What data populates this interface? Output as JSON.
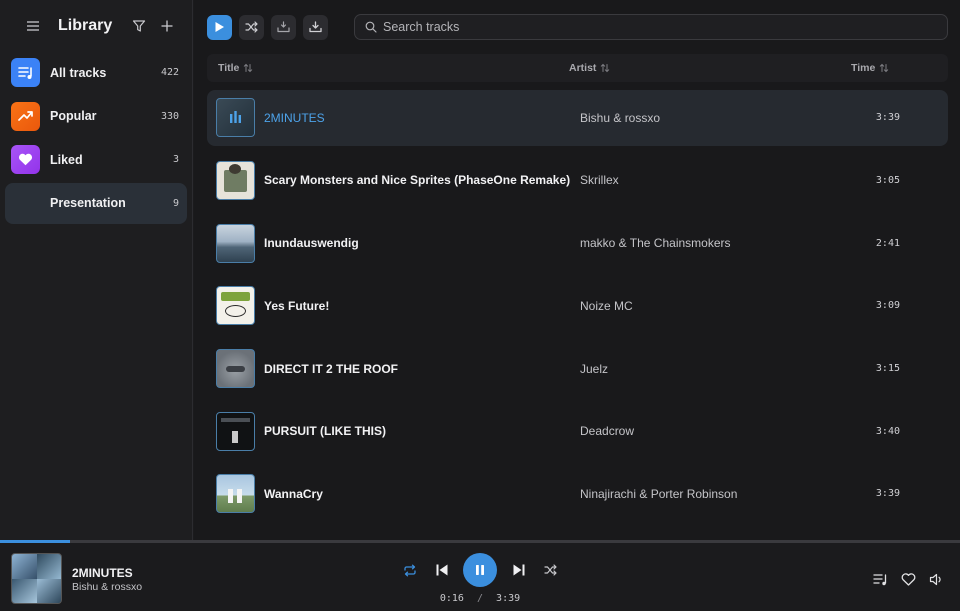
{
  "sidebar": {
    "title": "Library",
    "items": [
      {
        "label": "All tracks",
        "count": "422",
        "icon": "playlist-icon",
        "color": "#3b82f6"
      },
      {
        "label": "Popular",
        "count": "330",
        "icon": "trending-up-icon",
        "color": "#f97316"
      },
      {
        "label": "Liked",
        "count": "3",
        "icon": "heart-icon",
        "color": "#a855f7"
      },
      {
        "label": "Presentation",
        "count": "9",
        "icon": "playlist-cover",
        "active": true
      }
    ]
  },
  "toolbar": {
    "search_placeholder": "Search tracks"
  },
  "table": {
    "headers": {
      "title": "Title",
      "artist": "Artist",
      "time": "Time"
    },
    "rows": [
      {
        "title": "2MINUTES",
        "artist": "Bishu & rossxo",
        "time": "3:39",
        "active": true
      },
      {
        "title": "Scary Monsters and Nice Sprites (PhaseOne Remake)",
        "artist": "Skrillex",
        "time": "3:05"
      },
      {
        "title": "Inundauswendig",
        "artist": "makko & The Chainsmokers",
        "time": "2:41"
      },
      {
        "title": "Yes Future!",
        "artist": "Noize MC",
        "time": "3:09"
      },
      {
        "title": "DIRECT IT 2 THE ROOF",
        "artist": "Juelz",
        "time": "3:15"
      },
      {
        "title": "PURSUIT (LIKE THIS)",
        "artist": "Deadcrow",
        "time": "3:40"
      },
      {
        "title": "WannaCry",
        "artist": "Ninajirachi & Porter Robinson",
        "time": "3:39"
      }
    ]
  },
  "player": {
    "title": "2MINUTES",
    "artist": "Bishu & rossxo",
    "elapsed": "0:16",
    "separator": "/",
    "duration": "3:39",
    "progress_fraction": 0.073,
    "accent": "#3b8fde"
  }
}
